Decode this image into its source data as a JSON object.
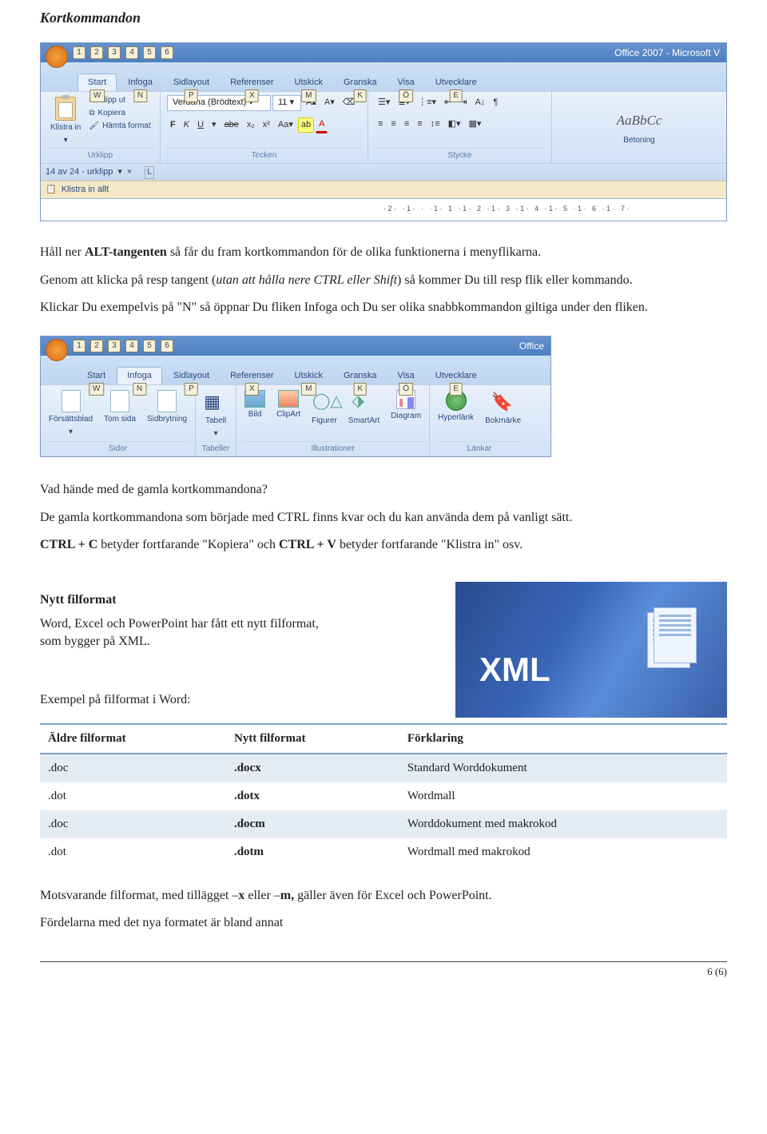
{
  "heading": "Kortkommandon",
  "titlebar1": "Office 2007 - Microsoft V",
  "titlebar2": "Office",
  "tabs": [
    "Start",
    "Infoga",
    "Sidlayout",
    "Referenser",
    "Utskick",
    "Granska",
    "Visa",
    "Utvecklare"
  ],
  "tab_keys": [
    "W",
    "N",
    "P",
    "X",
    "M",
    "K",
    "Ö",
    "E"
  ],
  "qat_nums": [
    "1",
    "2",
    "3",
    "4",
    "5",
    "6"
  ],
  "clipboard": {
    "paste": "Klistra in",
    "cut": "Klipp ut",
    "copy": "Kopiera",
    "format": "Hämta format",
    "group": "Urklipp"
  },
  "font": {
    "name": "Verdana (Brödtext)",
    "size": "11",
    "bold": "F",
    "italic": "K",
    "underline": "U",
    "strike": "abe",
    "sub": "x₂",
    "sup": "x²",
    "case": "Aa",
    "highlight": "ab",
    "color": "A",
    "group": "Tecken"
  },
  "paragraph": {
    "group": "Stycke"
  },
  "style_preview": "AaBbCc",
  "style_name": "Betoning",
  "status": {
    "count": "14 av 24 - urklipp",
    "paste_all": "Klistra in allt"
  },
  "p1_pre": "Håll ner ",
  "p1_strong": "ALT-tangenten",
  "p1_post": " så får du fram kortkommandon för de olika funktionerna i menyflikarna.",
  "p2_pre": "Genom att klicka på resp tangent (",
  "p2_em": "utan att hålla nere CTRL eller Shift",
  "p2_post": ") så kommer Du till resp flik eller kommando.",
  "p3": "Klickar Du exempelvis på \"N\" så öppnar Du fliken Infoga och Du ser olika snabbkommandon giltiga under den fliken.",
  "insert": {
    "cover": "Försättsblad",
    "blank": "Tom sida",
    "break": "Sidbrytning",
    "pages_group": "Sidor",
    "table": "Tabell",
    "tables_group": "Tabeller",
    "picture": "Bild",
    "clipart": "ClipArt",
    "shapes": "Figurer",
    "smartart": "SmartArt",
    "chart": "Diagram",
    "illus_group": "Illustrationer",
    "hyperlink": "Hyperlänk",
    "bookmark": "Bokmärke",
    "links_group": "Länkar"
  },
  "q1": "Vad hände med de gamla kortkommandona?",
  "q2": "De gamla kortkommandona som började med CTRL finns kvar och du kan använda dem på vanligt sätt.",
  "q3_pre": "",
  "q3_s1": "CTRL + C",
  "q3_mid": " betyder fortfarande \"Kopiera\" och ",
  "q3_s2": "CTRL + V",
  "q3_post": " betyder fortfarande \"Klistra in\" osv.",
  "nytt_h": "Nytt filformat",
  "nytt_p": "Word, Excel och PowerPoint har fått ett nytt filformat, som bygger på XML.",
  "ex_h": "Exempel på filformat i Word:",
  "xml_label": "XML",
  "table_headers": [
    "Äldre filformat",
    "Nytt filformat",
    "Förklaring"
  ],
  "table_rows": [
    {
      "old": ".doc",
      "new": ".docx",
      "desc": "Standard Worddokument"
    },
    {
      "old": ".dot",
      "new": ".dotx",
      "desc": "Wordmall"
    },
    {
      "old": ".doc",
      "new": ".docm",
      "desc": "Worddokument med makrokod"
    },
    {
      "old": ".dot",
      "new": ".dotm",
      "desc": "Wordmall med makrokod"
    }
  ],
  "foot1_pre": "Motsvarande filformat, med tillägget –",
  "foot1_x": "x",
  "foot1_mid": " eller –",
  "foot1_m": "m,",
  "foot1_post": " gäller även för Excel och PowerPoint.",
  "foot2": "Fördelarna med det nya formatet är bland annat",
  "page_num": "6 (6)"
}
